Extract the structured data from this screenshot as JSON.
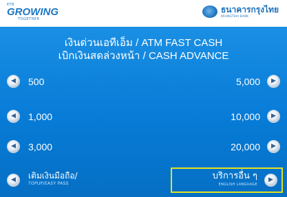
{
  "header": {
    "left_logo_small": "KTB",
    "left_logo_brand": "GROWING",
    "left_logo_sub": "TOGETHER",
    "right_logo_name": "ธนาคารกรุงไทย",
    "right_logo_en": "KRUNGTHAI BANK"
  },
  "title": {
    "line1": "เงินด่วนเอทีเอ็ม / ATM FAST CASH",
    "line2": "เบิกเงินสดล่วงหน้า / CASH ADVANCE"
  },
  "left_buttons": [
    "500",
    "1,000",
    "3,000"
  ],
  "right_buttons": [
    "5,000",
    "10,000",
    "20,000"
  ],
  "topup": {
    "label": "เติมเงินมือถือ/",
    "sub": "TOPUP/EASY PASS"
  },
  "other": {
    "label": "บริการอื่น ๆ",
    "sub": "ENGLISH LANGUAGE"
  }
}
